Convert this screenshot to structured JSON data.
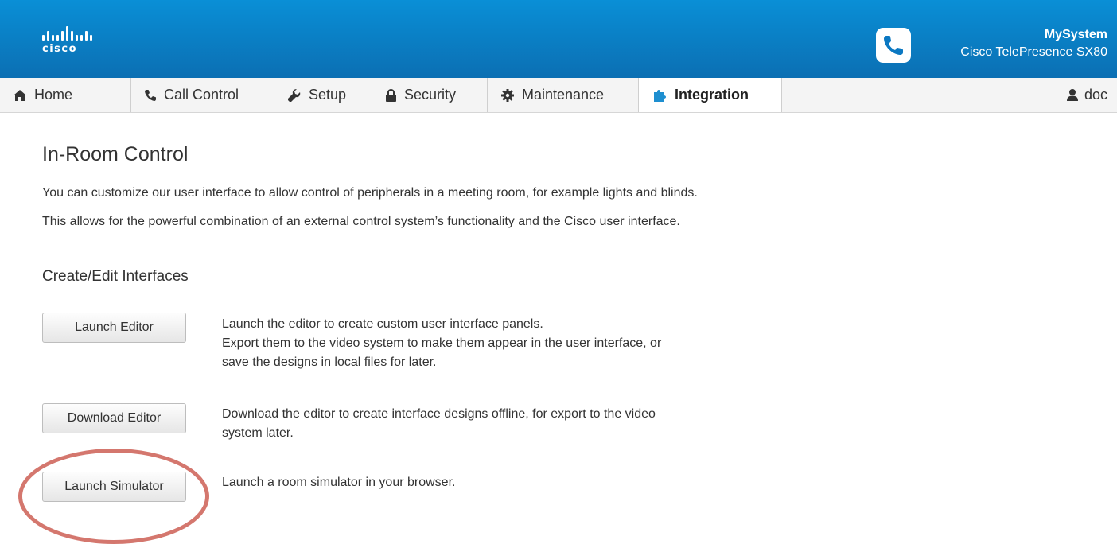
{
  "header": {
    "brand": "cisco",
    "system_name": "MySystem",
    "system_model": "Cisco TelePresence SX80"
  },
  "nav": {
    "tabs": [
      {
        "label": "Home",
        "icon": "home-icon"
      },
      {
        "label": "Call Control",
        "icon": "phone-icon"
      },
      {
        "label": "Setup",
        "icon": "wrench-icon"
      },
      {
        "label": "Security",
        "icon": "lock-icon"
      },
      {
        "label": "Maintenance",
        "icon": "gear-icon"
      },
      {
        "label": "Integration",
        "icon": "puzzle-icon",
        "active": true
      }
    ],
    "user": {
      "label": "doc",
      "icon": "user-icon"
    }
  },
  "page": {
    "title": "In-Room Control",
    "intro_1": "You can customize our user interface to allow control of peripherals in a meeting room, for example lights and blinds.",
    "intro_2": "This allows for the powerful combination of an external control system’s functionality and the Cisco user interface.",
    "section_title": "Create/Edit Interfaces"
  },
  "actions": [
    {
      "button": "Launch Editor",
      "lines": [
        "Launch the editor to create custom user interface panels.",
        "Export them to the video system to make them appear in the user interface, or",
        "save the designs in local files for later."
      ]
    },
    {
      "button": "Download Editor",
      "lines": [
        "Download the editor to create interface designs offline, for export to the video",
        "system later."
      ]
    },
    {
      "button": "Launch Simulator",
      "lines": [
        "Launch a room simulator in your browser."
      ],
      "highlighted": true
    }
  ],
  "colors": {
    "header_top": "#0a8fd6",
    "header_bottom": "#0b6fb3",
    "highlight_ring": "#d4776e",
    "integration_icon": "#1e8fd0"
  }
}
